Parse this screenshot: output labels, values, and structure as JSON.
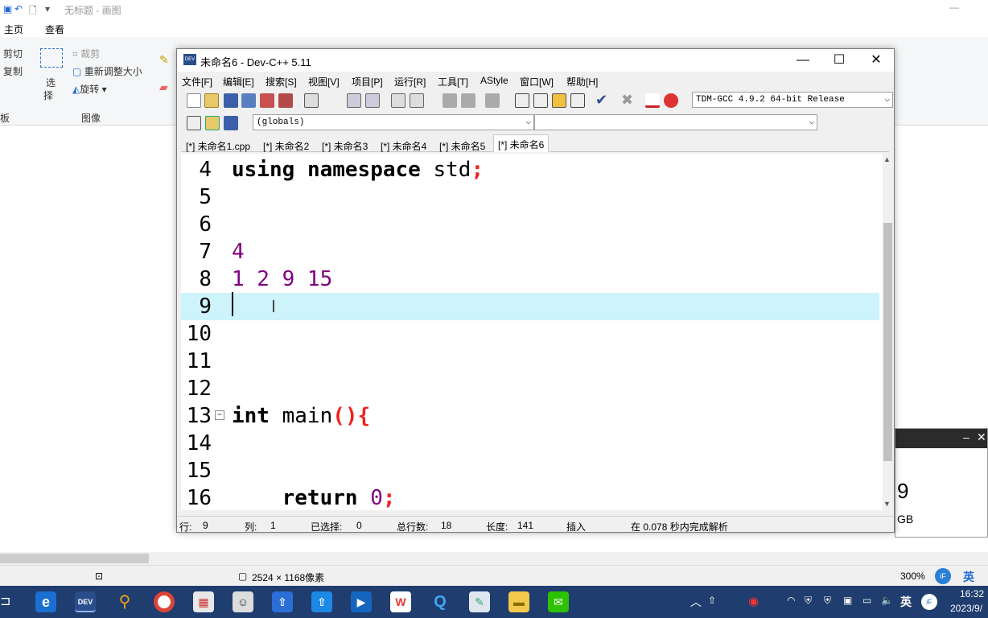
{
  "paint": {
    "title": "无标题 - 画图",
    "tabs": [
      "主页",
      "查看"
    ],
    "ribbon": {
      "cut": "剪切",
      "copy": "复制",
      "select": "选",
      "select2": "择",
      "crop": "裁剪",
      "resize": "重新调整大小",
      "rotate": "旋转",
      "image_group": "图像",
      "clip_group": "板"
    },
    "status": {
      "dimensions": "2524 × 1168像素",
      "zoom": "300%"
    }
  },
  "bg_window": {
    "big_text": "9",
    "unit_text": "GB"
  },
  "devcpp": {
    "title": "未命名6 - Dev-C++ 5.11",
    "menu": [
      "文件[F]",
      "编辑[E]",
      "搜索[S]",
      "视图[V]",
      "项目[P]",
      "运行[R]",
      "工具[T]",
      "AStyle",
      "窗口[W]",
      "帮助[H]"
    ],
    "compiler": "TDM-GCC 4.9.2 64-bit Release",
    "scope": "(globals)",
    "tabs": [
      "[*] 未命名1.cpp",
      "[*] 未命名2",
      "[*] 未命名3",
      "[*] 未命名4",
      "[*] 未命名5",
      "[*] 未命名6"
    ],
    "active_tab": 5,
    "code_lines": [
      {
        "num": "4",
        "text": "using namespace std;"
      },
      {
        "num": "5",
        "text": ""
      },
      {
        "num": "6",
        "text": ""
      },
      {
        "num": "7",
        "text": "4"
      },
      {
        "num": "8",
        "text": "1 2 9 15"
      },
      {
        "num": "9",
        "text": ""
      },
      {
        "num": "10",
        "text": ""
      },
      {
        "num": "11",
        "text": ""
      },
      {
        "num": "12",
        "text": ""
      },
      {
        "num": "13",
        "text": "int main(){"
      },
      {
        "num": "14",
        "text": ""
      },
      {
        "num": "15",
        "text": ""
      },
      {
        "num": "16",
        "text": "    return 0;"
      }
    ],
    "status": {
      "row_label": "行:",
      "row": "9",
      "col_label": "列:",
      "col": "1",
      "sel_label": "已选择:",
      "sel": "0",
      "total_label": "总行数:",
      "total": "18",
      "len_label": "长度:",
      "len": "141",
      "mode": "插入",
      "parse": "在 0.078 秒内完成解析"
    }
  },
  "taskbar": {
    "ime": "英",
    "time": "16:32",
    "date": "2023/9/"
  }
}
